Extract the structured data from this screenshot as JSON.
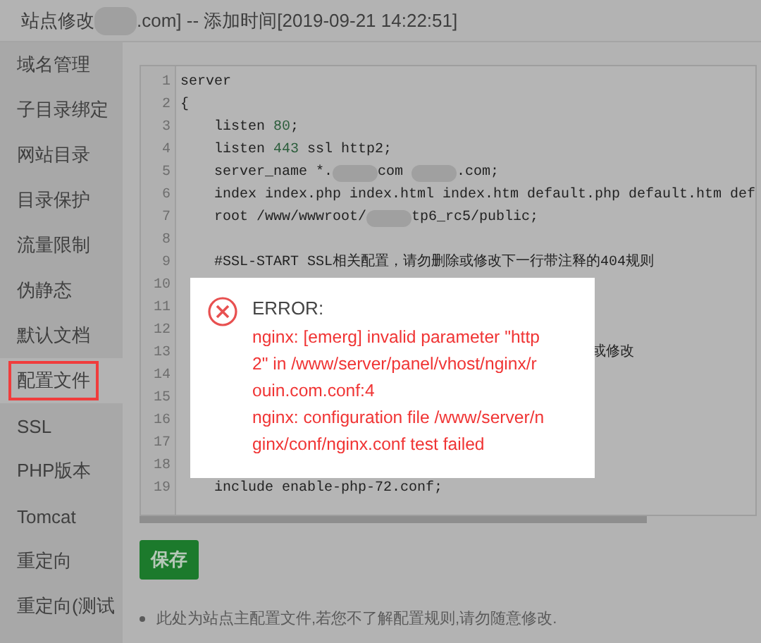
{
  "header": {
    "title_parts": [
      "站点修改",
      ".com] -- 添加时间[2019-09-21 14:22:51]"
    ]
  },
  "sidebar": {
    "items": [
      {
        "label": "域名管理",
        "selected": false
      },
      {
        "label": "子目录绑定",
        "selected": false
      },
      {
        "label": "网站目录",
        "selected": false
      },
      {
        "label": "目录保护",
        "selected": false
      },
      {
        "label": "流量限制",
        "selected": false
      },
      {
        "label": "伪静态",
        "selected": false
      },
      {
        "label": "默认文档",
        "selected": false
      },
      {
        "label": "配置文件",
        "selected": true
      },
      {
        "label": "SSL",
        "selected": false
      },
      {
        "label": "PHP版本",
        "selected": false
      },
      {
        "label": "Tomcat",
        "selected": false
      },
      {
        "label": "重定向",
        "selected": false
      },
      {
        "label": "重定向(测试",
        "selected": false
      }
    ]
  },
  "editor": {
    "lines": [
      {
        "number": "1",
        "parts": [
          {
            "kind": "code",
            "text": "server"
          }
        ]
      },
      {
        "number": "2",
        "parts": [
          {
            "kind": "code",
            "text": "{"
          }
        ]
      },
      {
        "number": "3",
        "parts": [
          {
            "kind": "indent"
          },
          {
            "kind": "code",
            "text": "listen "
          },
          {
            "kind": "number",
            "text": "80"
          },
          {
            "kind": "code",
            "text": ";"
          }
        ]
      },
      {
        "number": "4",
        "parts": [
          {
            "kind": "indent"
          },
          {
            "kind": "code",
            "text": "listen "
          },
          {
            "kind": "number",
            "text": "443"
          },
          {
            "kind": "code",
            "text": " ssl http2;"
          }
        ]
      },
      {
        "number": "5",
        "parts": [
          {
            "kind": "indent"
          },
          {
            "kind": "code",
            "text": "server_name *."
          },
          {
            "kind": "blur"
          },
          {
            "kind": "code",
            "text": "com "
          },
          {
            "kind": "blur"
          },
          {
            "kind": "code",
            "text": ".com;"
          }
        ]
      },
      {
        "number": "6",
        "parts": [
          {
            "kind": "indent"
          },
          {
            "kind": "code",
            "text": "index index.php index.html index.htm default.php default.htm def"
          }
        ]
      },
      {
        "number": "7",
        "parts": [
          {
            "kind": "indent"
          },
          {
            "kind": "code",
            "text": "root /www/wwwroot/"
          },
          {
            "kind": "blur"
          },
          {
            "kind": "code",
            "text": "tp6_rc5/public;"
          }
        ]
      },
      {
        "number": "8"
      },
      {
        "number": "9",
        "parts": [
          {
            "kind": "indent"
          },
          {
            "kind": "code",
            "text": "#SSL-START SSL相关配置，请勿删除或修改下一行带注释的404规则"
          }
        ]
      },
      {
        "number": "10"
      },
      {
        "number": "11"
      },
      {
        "number": "12"
      },
      {
        "number": "13",
        "parts": [
          {
            "kind": "gap"
          },
          {
            "kind": "code",
            "text": "或修改"
          }
        ]
      },
      {
        "number": "14"
      },
      {
        "number": "15"
      },
      {
        "number": "16"
      },
      {
        "number": "17"
      },
      {
        "number": "18"
      },
      {
        "number": "19",
        "parts": [
          {
            "kind": "indent"
          },
          {
            "kind": "code",
            "text": "include enable-php-72.conf;"
          }
        ]
      }
    ]
  },
  "save_button": {
    "label": "保存"
  },
  "note": "此处为站点主配置文件,若您不了解配置规则,请勿随意修改.",
  "dialog": {
    "title": "ERROR:",
    "lines": [
      "nginx: [emerg] invalid parameter \"http",
      "2\" in /www/server/panel/vhost/nginx/r",
      "ouin.com.conf:4",
      "nginx: configuration file /www/server/n",
      "ginx/conf/nginx.conf test failed"
    ]
  }
}
